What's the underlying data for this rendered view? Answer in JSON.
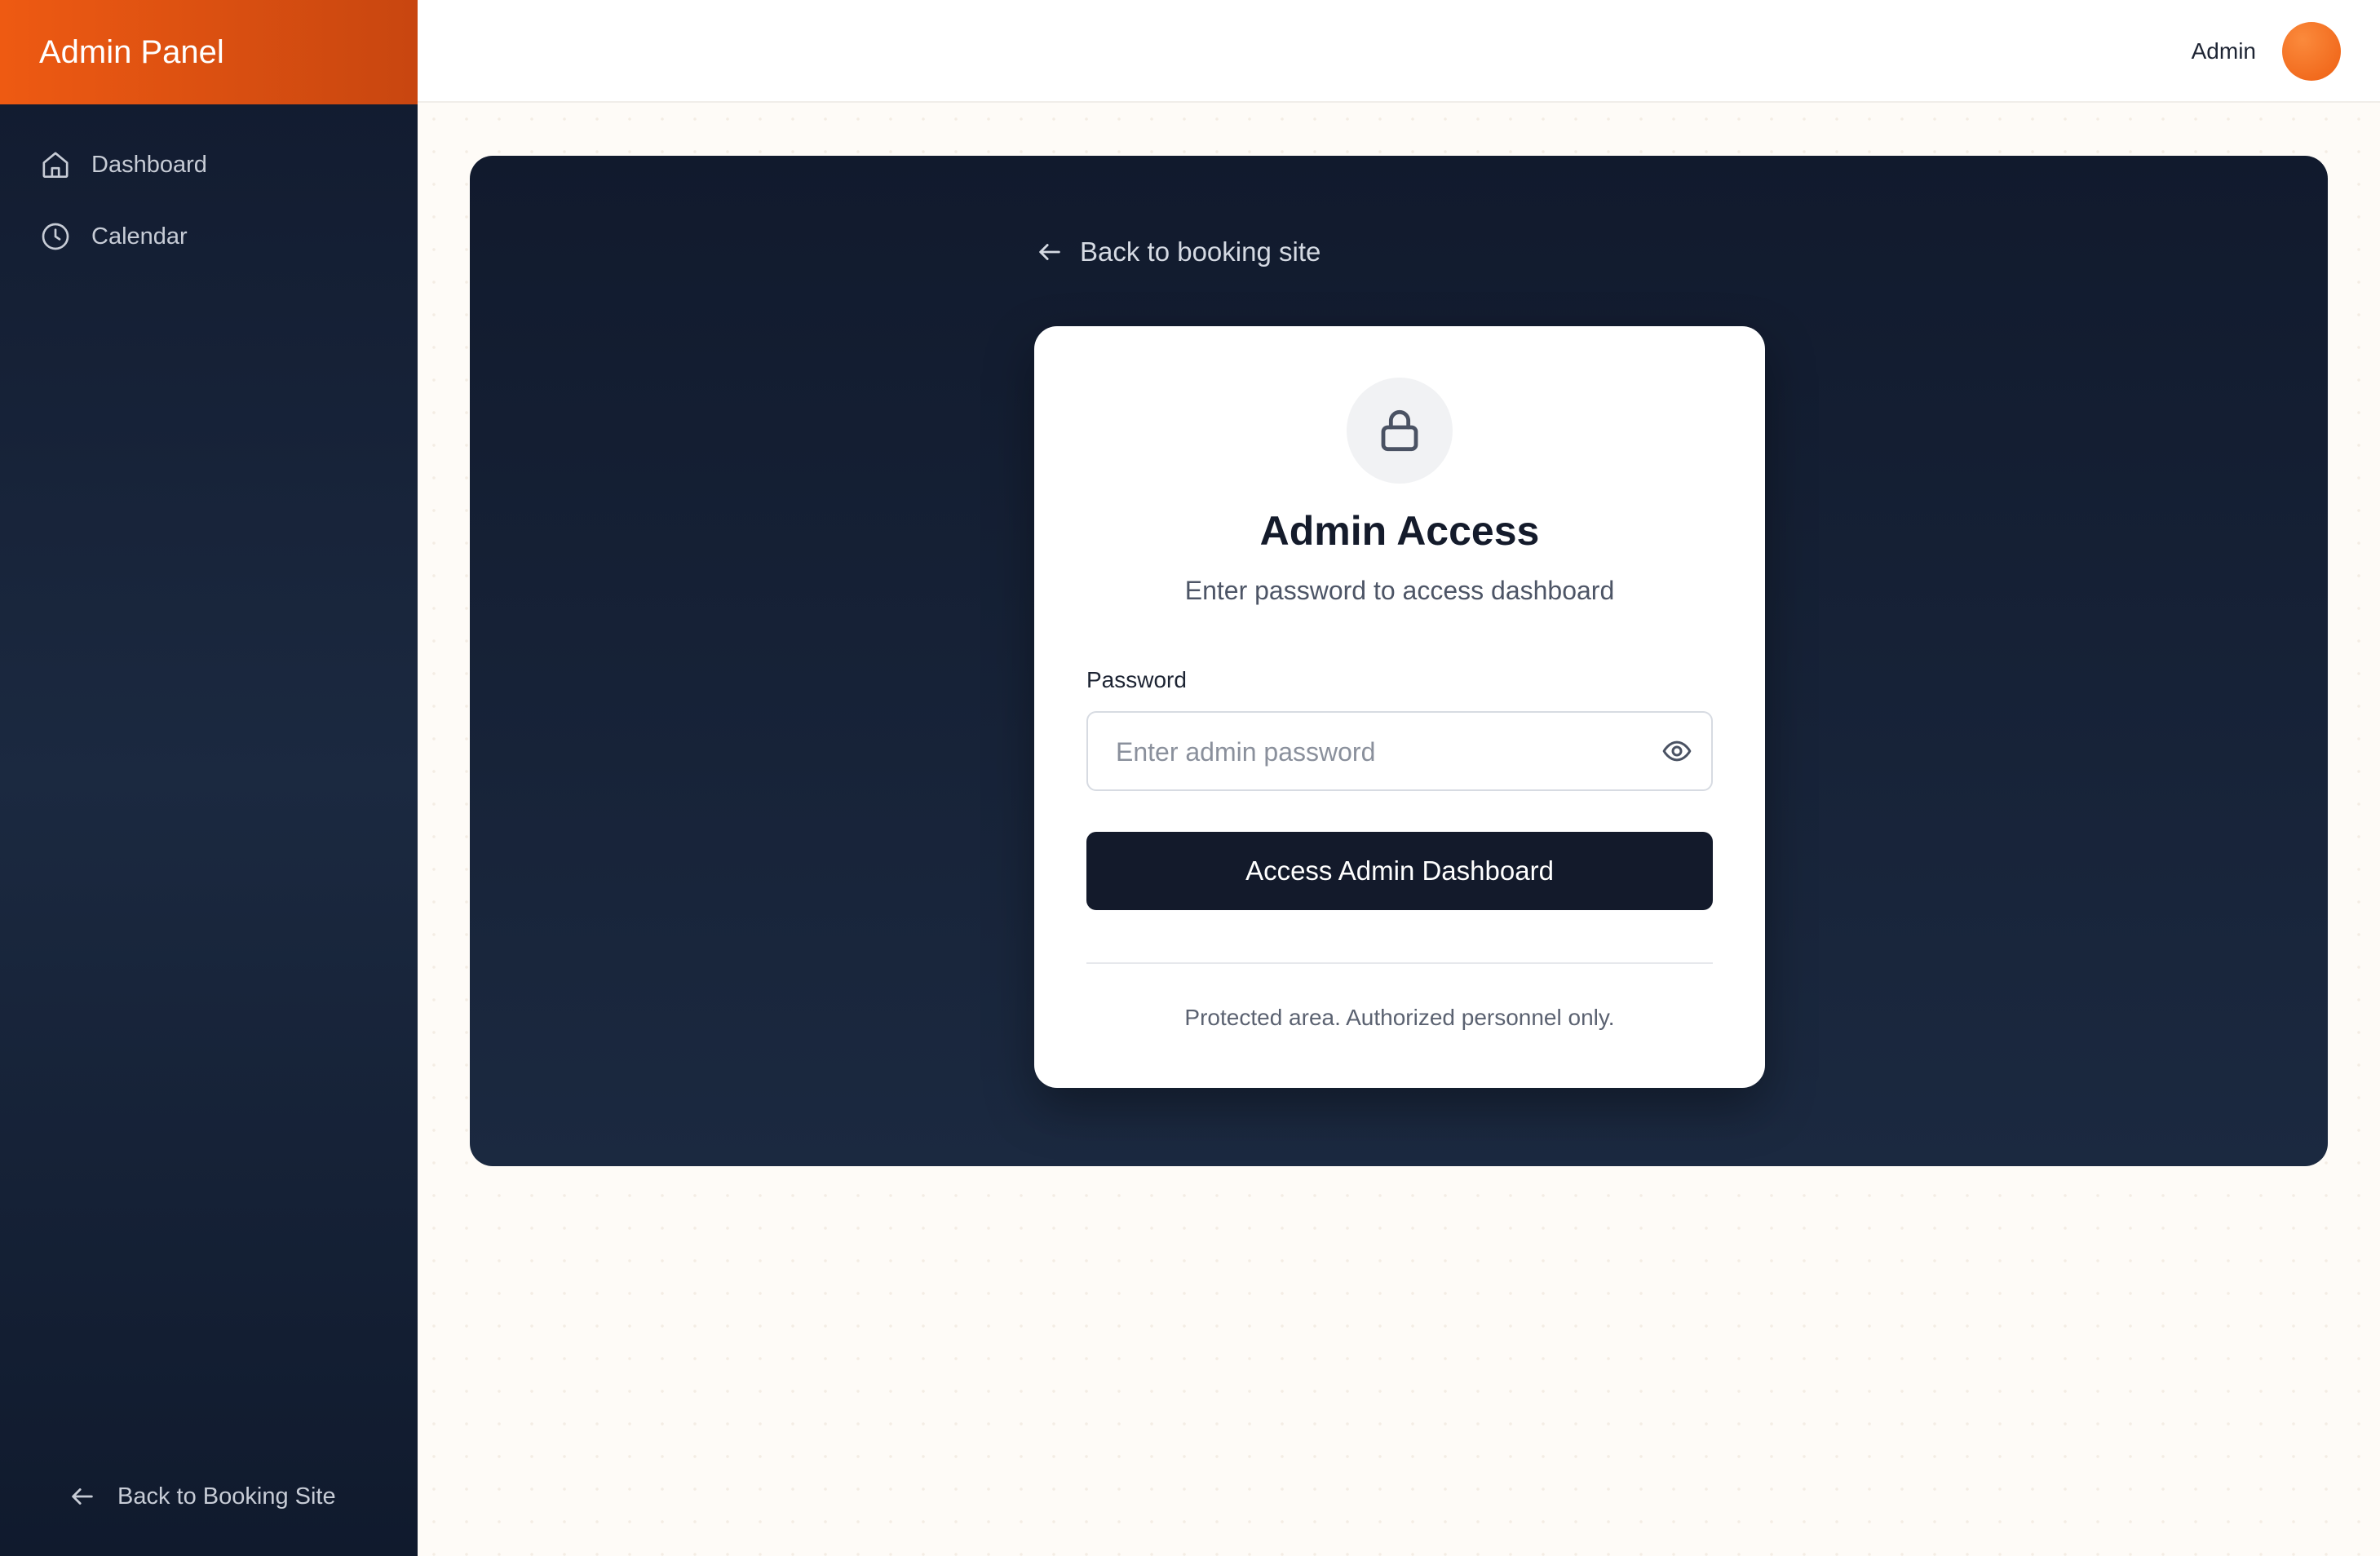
{
  "sidebar": {
    "brand": "Admin Panel",
    "items": [
      {
        "label": "Dashboard",
        "icon": "home-icon"
      },
      {
        "label": "Calendar",
        "icon": "clock-icon"
      }
    ],
    "back_label": "Back to Booking Site"
  },
  "header": {
    "user_name": "Admin"
  },
  "main": {
    "back_link": "Back to booking site",
    "card": {
      "title": "Admin Access",
      "subtitle": "Enter password to access dashboard",
      "password_label": "Password",
      "password_placeholder": "Enter admin password",
      "password_value": "",
      "submit_label": "Access Admin Dashboard",
      "note": "Protected area. Authorized personnel only."
    }
  },
  "colors": {
    "accent": "#ee5a12",
    "sidebar_bg": "#111a2e",
    "button_bg": "#131a2b"
  }
}
